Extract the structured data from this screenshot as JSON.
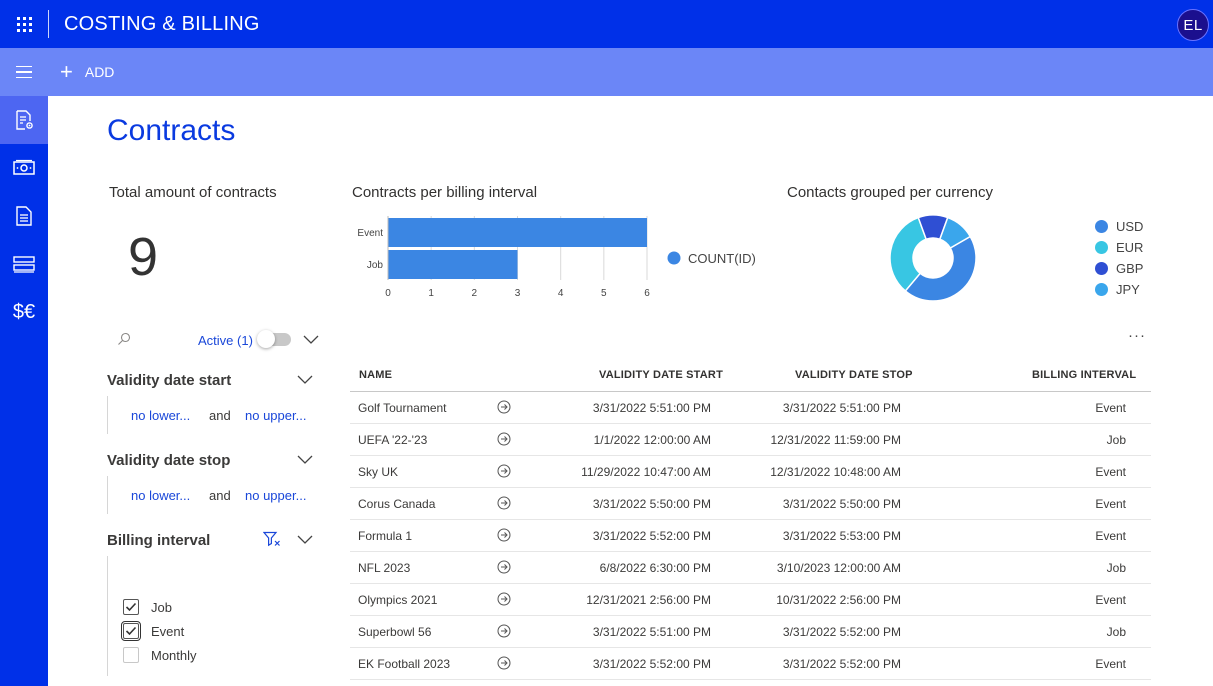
{
  "app": {
    "title": "COSTING & BILLING",
    "avatar_initials": "EL"
  },
  "command_bar": {
    "add_label": "ADD"
  },
  "rail": {
    "currency_glyph": "$€"
  },
  "page": {
    "title": "Contracts"
  },
  "kpi": {
    "title": "Total amount of contracts",
    "value": "9"
  },
  "bar_panel": {
    "title": "Contracts per billing interval"
  },
  "pie_panel": {
    "title": "Contacts grouped per currency"
  },
  "chart_data": [
    {
      "type": "bar",
      "orientation": "horizontal",
      "title": "Contracts per billing interval",
      "categories": [
        "Event",
        "Job"
      ],
      "series": [
        {
          "name": "COUNT(ID)",
          "values": [
            6,
            3
          ],
          "color": "#3b86e3"
        }
      ],
      "xlim": [
        0,
        6
      ],
      "xticks": [
        "0",
        "1",
        "2",
        "3",
        "4",
        "5",
        "6"
      ],
      "grid": true,
      "legend": "right"
    },
    {
      "type": "pie",
      "variant": "donut",
      "title": "Contacts grouped per currency",
      "labels": [
        "USD",
        "EUR",
        "GBP",
        "JPY"
      ],
      "values": [
        4,
        3,
        1,
        1
      ],
      "colors": [
        "#3b86e3",
        "#38c6e3",
        "#2f4fd3",
        "#3aa6ec"
      ],
      "legend": "right"
    }
  ],
  "filters": {
    "active_label": "Active (1)",
    "validity_start": {
      "title": "Validity date start",
      "lower": "no lower...",
      "and": "and",
      "upper": "no upper..."
    },
    "validity_stop": {
      "title": "Validity date stop",
      "lower": "no lower...",
      "and": "and",
      "upper": "no upper..."
    },
    "billing_interval": {
      "title": "Billing interval",
      "options": [
        {
          "label": "Job",
          "checked": true
        },
        {
          "label": "Event",
          "checked": true
        },
        {
          "label": "Monthly",
          "checked": false
        }
      ]
    }
  },
  "table": {
    "more_glyph": "···",
    "columns": [
      "NAME",
      "VALIDITY DATE START",
      "VALIDITY DATE STOP",
      "BILLING INTERVAL"
    ],
    "rows": [
      {
        "name": "Golf Tournament",
        "start": "3/31/2022 5:51:00 PM",
        "stop": "3/31/2022 5:51:00 PM",
        "interval": "Event"
      },
      {
        "name": "UEFA '22-'23",
        "start": "1/1/2022 12:00:00 AM",
        "stop": "12/31/2022 11:59:00 PM",
        "interval": "Job"
      },
      {
        "name": "Sky UK",
        "start": "11/29/2022 10:47:00 AM",
        "stop": "12/31/2022 10:48:00 AM",
        "interval": "Event"
      },
      {
        "name": "Corus Canada",
        "start": "3/31/2022 5:50:00 PM",
        "stop": "3/31/2022 5:50:00 PM",
        "interval": "Event"
      },
      {
        "name": "Formula 1",
        "start": "3/31/2022 5:52:00 PM",
        "stop": "3/31/2022 5:53:00 PM",
        "interval": "Event"
      },
      {
        "name": "NFL 2023",
        "start": "6/8/2022 6:30:00 PM",
        "stop": "3/10/2023 12:00:00 AM",
        "interval": "Job"
      },
      {
        "name": "Olympics 2021",
        "start": "12/31/2021 2:56:00 PM",
        "stop": "10/31/2022 2:56:00 PM",
        "interval": "Event"
      },
      {
        "name": "Superbowl 56",
        "start": "3/31/2022 5:51:00 PM",
        "stop": "3/31/2022 5:52:00 PM",
        "interval": "Job"
      },
      {
        "name": "EK Football 2023",
        "start": "3/31/2022 5:52:00 PM",
        "stop": "3/31/2022 5:52:00 PM",
        "interval": "Event"
      }
    ]
  }
}
